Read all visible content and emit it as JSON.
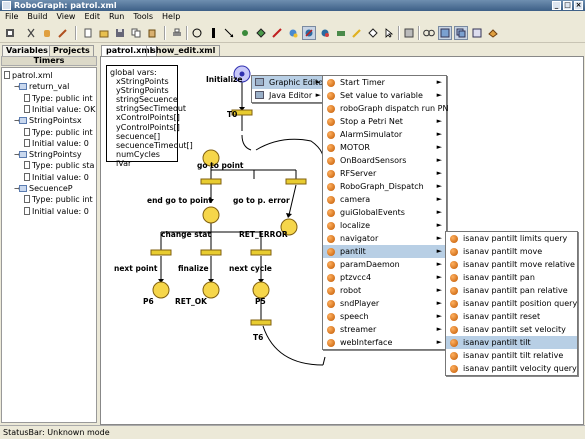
{
  "window": {
    "title": "RoboGraph: patrol.xml"
  },
  "menubar": [
    "File",
    "Build",
    "View",
    "Edit",
    "Run",
    "Tools",
    "Help"
  ],
  "left_tabs": [
    "Variables",
    "Projects"
  ],
  "timers_label": "Timers",
  "tree": [
    {
      "label": "patrol.xml",
      "level": 0,
      "kind": "doc"
    },
    {
      "label": "return_val",
      "level": 1,
      "kind": "folder"
    },
    {
      "label": "Type: public int",
      "level": 2,
      "kind": "doc"
    },
    {
      "label": "Initial value: OK",
      "level": 2,
      "kind": "doc"
    },
    {
      "label": "StringPointsx",
      "level": 1,
      "kind": "folder"
    },
    {
      "label": "Type: public int",
      "level": 2,
      "kind": "doc"
    },
    {
      "label": "Initial value: 0",
      "level": 2,
      "kind": "doc"
    },
    {
      "label": "StringPointsy",
      "level": 1,
      "kind": "folder"
    },
    {
      "label": "Type: public sta",
      "level": 2,
      "kind": "doc"
    },
    {
      "label": "Initial value: 0",
      "level": 2,
      "kind": "doc"
    },
    {
      "label": "SecuenceP",
      "level": 1,
      "kind": "folder"
    },
    {
      "label": "Type: public int",
      "level": 2,
      "kind": "doc"
    },
    {
      "label": "Initial value: 0",
      "level": 2,
      "kind": "doc"
    }
  ],
  "canvas_tabs": [
    "patrol.xml",
    "show_edit.xml"
  ],
  "globals": {
    "header": "global vars:",
    "items": [
      "xStringPoints",
      "yStringPoints",
      "stringSecuence",
      "stringSecTimeout",
      "xControlPoints[]",
      "yControlPoints[]",
      "secuence[]",
      "secuenceTimeout[]",
      "numCycles",
      "iVar"
    ]
  },
  "graph_labels": {
    "initialize": "Initialize",
    "t0": "T0",
    "go_to_point": "go to point",
    "end_go_to_point": "end go to point",
    "go_to_p_error": "go to p. error",
    "change_stat": "change stat",
    "ret_error": "RET_ERROR",
    "next_point": "next point",
    "finalize": "finalize",
    "next_cycle": "next cycle",
    "p6": "P6",
    "ret_ok": "RET_OK",
    "p5": "P5",
    "t6": "T6"
  },
  "menu1": [
    {
      "label": "Graphic Editor",
      "arrow": true,
      "highlight": true
    },
    {
      "label": "Java Editor",
      "arrow": true,
      "highlight": false
    }
  ],
  "menu2": [
    {
      "label": "Start Timer",
      "arrow": true
    },
    {
      "label": "Set value to variable",
      "arrow": true
    },
    {
      "label": "roboGraph dispatch run PN",
      "arrow": false
    },
    {
      "label": "Stop a Petri Net",
      "arrow": true
    },
    {
      "label": "AlarmSimulator",
      "arrow": true
    },
    {
      "label": "MOTOR",
      "arrow": true
    },
    {
      "label": "OnBoardSensors",
      "arrow": true
    },
    {
      "label": "RFServer",
      "arrow": true
    },
    {
      "label": "RoboGraph_Dispatch",
      "arrow": true
    },
    {
      "label": "camera",
      "arrow": true
    },
    {
      "label": "guiGlobalEvents",
      "arrow": true
    },
    {
      "label": "localize",
      "arrow": true
    },
    {
      "label": "navigator",
      "arrow": true
    },
    {
      "label": "pantilt",
      "arrow": true,
      "highlight": true
    },
    {
      "label": "paramDaemon",
      "arrow": true
    },
    {
      "label": "ptzvcc4",
      "arrow": true
    },
    {
      "label": "robot",
      "arrow": true
    },
    {
      "label": "sndPlayer",
      "arrow": true
    },
    {
      "label": "speech",
      "arrow": true
    },
    {
      "label": "streamer",
      "arrow": true
    },
    {
      "label": "webInterface",
      "arrow": true
    }
  ],
  "menu3": [
    {
      "label": "isanav pantilt limits query"
    },
    {
      "label": "isanav pantilt move"
    },
    {
      "label": "isanav pantilt move relative"
    },
    {
      "label": "isanav pantilt pan"
    },
    {
      "label": "isanav pantilt pan relative"
    },
    {
      "label": "isanav pantilt position query"
    },
    {
      "label": "isanav pantilt reset"
    },
    {
      "label": "isanav pantilt set velocity"
    },
    {
      "label": "isanav pantilt tilt",
      "highlight": true
    },
    {
      "label": "isanav pantilt tilt relative"
    },
    {
      "label": "isanav pantilt velocity query"
    }
  ],
  "statusbar": "StatusBar: Unknown mode",
  "colors": {
    "place": "#f6d64a",
    "place_marked": "#c8c8f8",
    "transition": "#e8cc30",
    "menu_highlight": "#b8cfe5"
  }
}
